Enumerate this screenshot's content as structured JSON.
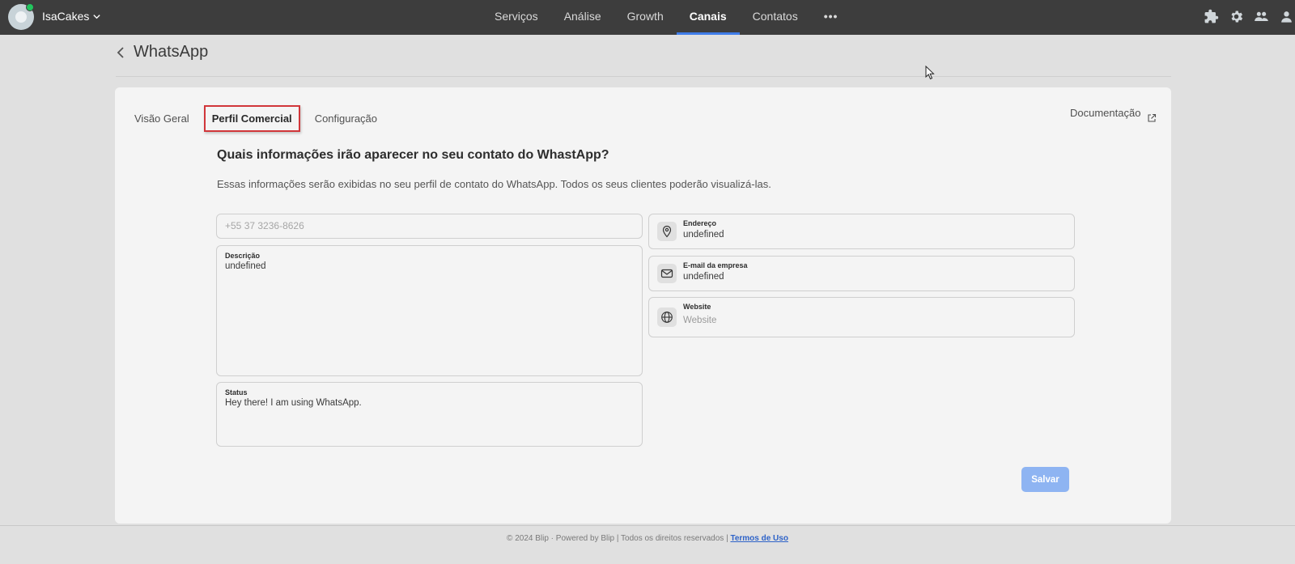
{
  "topbar": {
    "account_name": "IsaCakes",
    "nav": [
      {
        "label": "Serviços"
      },
      {
        "label": "Análise"
      },
      {
        "label": "Growth"
      },
      {
        "label": "Canais",
        "active": true
      },
      {
        "label": "Contatos"
      }
    ],
    "more_label": "•••",
    "icons": [
      "puzzle-icon",
      "gear-icon",
      "team-icon",
      "user-icon"
    ]
  },
  "header": {
    "title": "WhatsApp"
  },
  "tabs": [
    {
      "label": "Visão Geral"
    },
    {
      "label": "Perfil Comercial",
      "active": true
    },
    {
      "label": "Configuração"
    }
  ],
  "documentation_label": "Documentação",
  "form": {
    "heading": "Quais informações irão aparecer no seu contato do WhastApp?",
    "subheading": "Essas informações serão exibidas no seu perfil de contato do WhatsApp. Todos os seus clientes poderão visualizá-las.",
    "phone_placeholder": "+55 37 3236-8626",
    "description": {
      "label": "Descrição",
      "value": "undefined"
    },
    "status": {
      "label": "Status",
      "value": "Hey there! I am using WhatsApp."
    },
    "address": {
      "label": "Endereço",
      "value": "undefined"
    },
    "email": {
      "label": "E-mail da empresa",
      "value": "undefined"
    },
    "website": {
      "label": "Website",
      "placeholder": "Website"
    },
    "save_label": "Salvar"
  },
  "footer": {
    "text": "© 2024 Blip · Powered by Blip | Todos os direitos reservados | ",
    "terms_label": "Termos de Uso"
  },
  "colors": {
    "topbar_bg": "#3d3d3d",
    "accent_blue": "#3f7de8",
    "save_button": "#8eb4f2",
    "highlight_border": "#d1363a",
    "online_dot": "#22c55e"
  }
}
